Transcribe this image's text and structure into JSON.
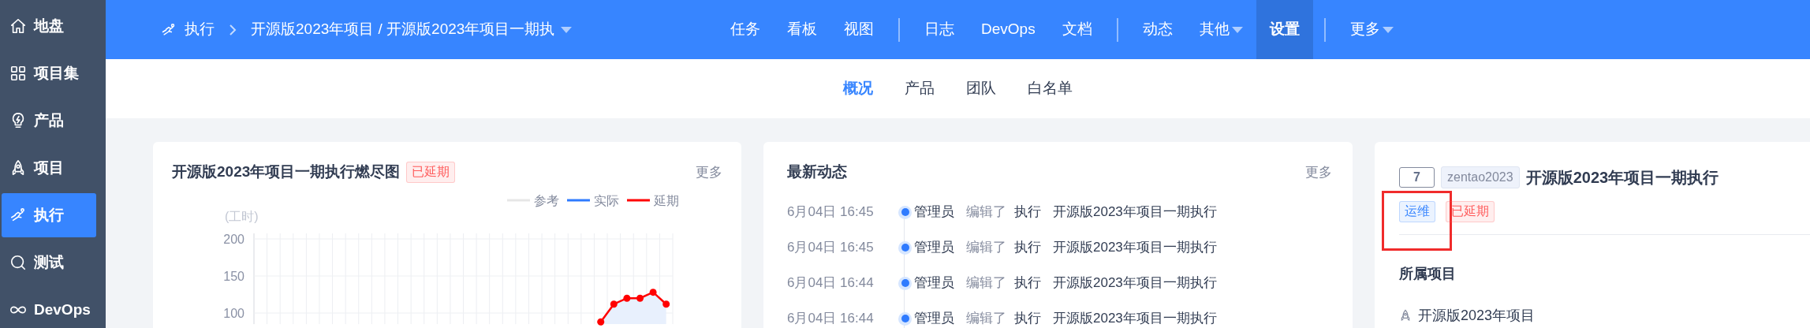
{
  "sidebar": {
    "items": [
      {
        "label": "地盘",
        "selected": false
      },
      {
        "label": "项目集",
        "selected": false
      },
      {
        "label": "产品",
        "selected": false
      },
      {
        "label": "项目",
        "selected": false
      },
      {
        "label": "执行",
        "selected": true
      },
      {
        "label": "测试",
        "selected": false
      },
      {
        "label": "DevOps",
        "selected": false
      }
    ]
  },
  "topbar": {
    "breadcrumb": {
      "module": "执行",
      "title": "开源版2023年项目 / 开源版2023年项目一期执"
    },
    "nav_groups": [
      [
        {
          "label": "任务",
          "selected": false,
          "dropdown": false
        },
        {
          "label": "看板",
          "selected": false,
          "dropdown": false
        },
        {
          "label": "视图",
          "selected": false,
          "dropdown": false
        }
      ],
      [
        {
          "label": "日志",
          "selected": false,
          "dropdown": false
        },
        {
          "label": "DevOps",
          "selected": false,
          "dropdown": false
        },
        {
          "label": "文档",
          "selected": false,
          "dropdown": false
        }
      ],
      [
        {
          "label": "动态",
          "selected": false,
          "dropdown": false
        },
        {
          "label": "其他",
          "selected": false,
          "dropdown": true
        },
        {
          "label": "设置",
          "selected": true,
          "dropdown": false
        }
      ],
      [
        {
          "label": "更多",
          "selected": false,
          "dropdown": true
        }
      ]
    ]
  },
  "subnav": {
    "tabs": [
      {
        "label": "概况",
        "selected": true
      },
      {
        "label": "产品",
        "selected": false
      },
      {
        "label": "团队",
        "selected": false
      },
      {
        "label": "白名单",
        "selected": false
      }
    ]
  },
  "burndown_card": {
    "title": "开源版2023年项目一期执行燃尽图",
    "status": {
      "label": "已延期",
      "color": "#ff5d5d"
    },
    "more": "更多",
    "chart_data": {
      "type": "line",
      "ylabel": "(工时)",
      "ylim": [
        85,
        200
      ],
      "yticks": [
        100,
        150,
        200
      ],
      "series": [
        {
          "name": "参考",
          "color": "#e6e6e6",
          "values": [
            null,
            null,
            null,
            null,
            null,
            null,
            null,
            null,
            null,
            null,
            null,
            null,
            null,
            null,
            null,
            null,
            null,
            null,
            null,
            null,
            null,
            null,
            null,
            null,
            null,
            null,
            null,
            null,
            null,
            null,
            null,
            null
          ]
        },
        {
          "name": "实际",
          "color": "#2f7bff",
          "values": [
            null,
            null,
            null,
            null,
            null,
            null,
            null,
            null,
            null,
            null,
            null,
            null,
            null,
            null,
            null,
            null,
            null,
            null,
            null,
            null,
            null,
            null,
            null,
            null,
            null,
            null,
            null,
            null,
            null,
            null,
            null,
            null
          ]
        },
        {
          "name": "延期",
          "color": "#ff0000",
          "marker": "o",
          "values": [
            null,
            null,
            null,
            null,
            null,
            null,
            null,
            null,
            null,
            null,
            null,
            null,
            null,
            null,
            null,
            null,
            null,
            null,
            null,
            null,
            null,
            null,
            null,
            null,
            null,
            null,
            88,
            112,
            120,
            120,
            128,
            112
          ]
        }
      ]
    }
  },
  "activity_card": {
    "title": "最新动态",
    "more": "更多",
    "entries": [
      {
        "time": "6月04日 16:45",
        "user": "管理员",
        "action": "编辑了",
        "object_type": "执行",
        "object_name": "开源版2023年项目一期执行"
      },
      {
        "time": "6月04日 16:45",
        "user": "管理员",
        "action": "编辑了",
        "object_type": "执行",
        "object_name": "开源版2023年项目一期执行"
      },
      {
        "time": "6月04日 16:44",
        "user": "管理员",
        "action": "编辑了",
        "object_type": "执行",
        "object_name": "开源版2023年项目一期执行"
      },
      {
        "time": "6月04日 16:44",
        "user": "管理员",
        "action": "编辑了",
        "object_type": "执行",
        "object_name": "开源版2023年项目一期执行"
      }
    ]
  },
  "detail_card": {
    "id": "7",
    "code": "zentao2023",
    "title": "开源版2023年项目一期执行",
    "tags": [
      {
        "label": "运维",
        "color": "#3785ff",
        "highlighted": true
      },
      {
        "label": "已延期",
        "color": "#ff5d5d",
        "highlighted": false
      }
    ],
    "project_section": {
      "heading": "所属项目",
      "project": "开源版2023年项目"
    }
  }
}
